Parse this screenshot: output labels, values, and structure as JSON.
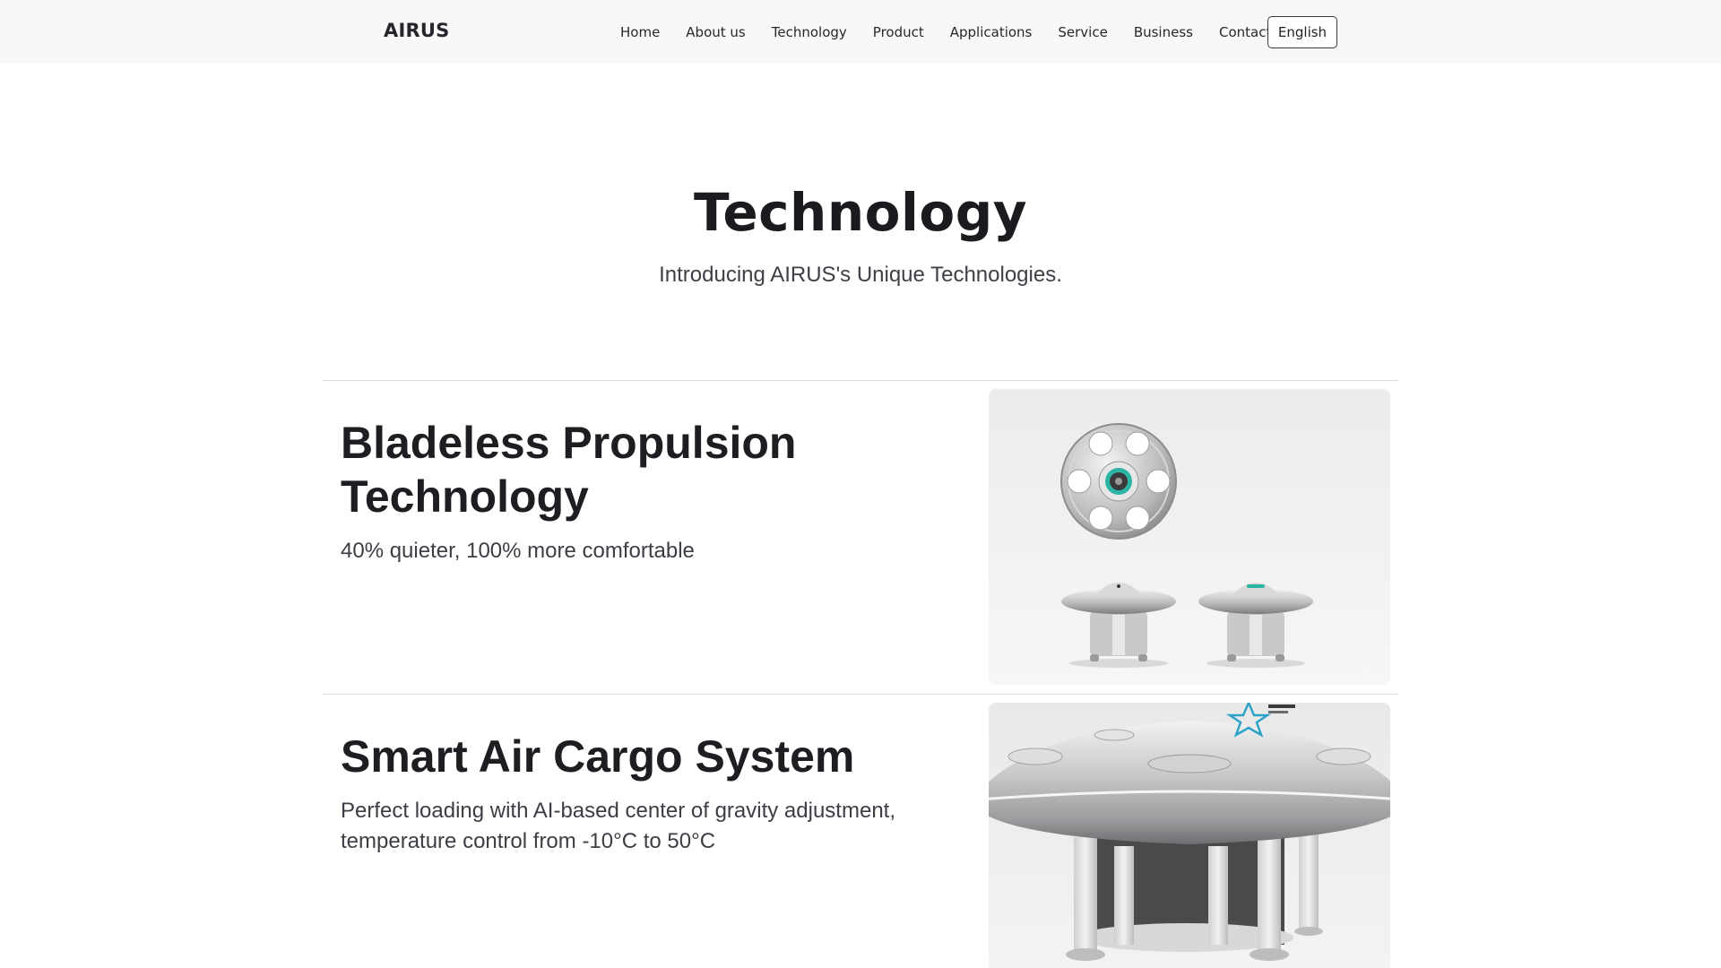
{
  "header": {
    "logo": "AIRUS",
    "nav": [
      "Home",
      "About us",
      "Technology",
      "Product",
      "Applications",
      "Service",
      "Business",
      "Contact"
    ],
    "language_button": "English"
  },
  "hero": {
    "title": "Technology",
    "subtitle": "Introducing AIRUS's Unique Technologies."
  },
  "features": [
    {
      "title_line1": "Bladeless Propulsion",
      "title_line2": "Technology",
      "description_line1": "40% quieter, 100% more comfortable"
    },
    {
      "title_line1": "Smart Air Cargo System",
      "description_line1": "Perfect loading with AI-based center of  gravity adjustment,",
      "description_line2": "temperature control from -10°C to 50°C"
    }
  ],
  "colors": {
    "nav_background": "#f8f8f8",
    "text_dark": "#1f2024",
    "text_muted": "#3e4047",
    "divider": "#dadada",
    "accent_teal": "#2bb5a4"
  }
}
